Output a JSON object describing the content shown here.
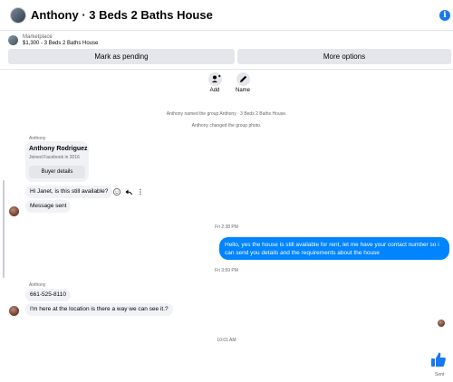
{
  "header": {
    "title": "Anthony · 3 Beds 2 Baths House"
  },
  "marketplace": {
    "label": "Marketplace",
    "listing": "$1,300 - 3 Beds 2 Baths House",
    "mark_pending": "Mark as pending",
    "more_options": "More options"
  },
  "actions": {
    "add": "Add",
    "name": "Name"
  },
  "system": {
    "named": "Anthony named the group Anthony · 3 Beds 2 Baths House.",
    "photo": "Anthony changed the group photo."
  },
  "card": {
    "sender": "Anthony",
    "name": "Anthony Rodriguez",
    "joined": "Joined Facebook in 2016",
    "buyer_details": "Buyer details"
  },
  "messages": {
    "m1": "Hi Janet, is this still available?",
    "m2": "Message sent",
    "ts1": "Fri 2:38 PM",
    "out1": "Hello, yes the house is still available for rent, let me have your contact number so i can send you details and the requirements about the house",
    "ts2": "Fri 3:59 PM",
    "sender2": "Anthony",
    "m3": "661-525-8110",
    "m4": "I'm here at the location is there a way we can see it.?",
    "ts3": "10:01 AM"
  },
  "footer": {
    "sent": "Sent"
  },
  "colors": {
    "accent": "#0084ff",
    "like": "#1877f2"
  },
  "icons": [
    "info-icon",
    "add-person-icon",
    "pencil-icon",
    "emoji-icon",
    "reply-icon",
    "more-icon",
    "thumbs-up-icon"
  ]
}
